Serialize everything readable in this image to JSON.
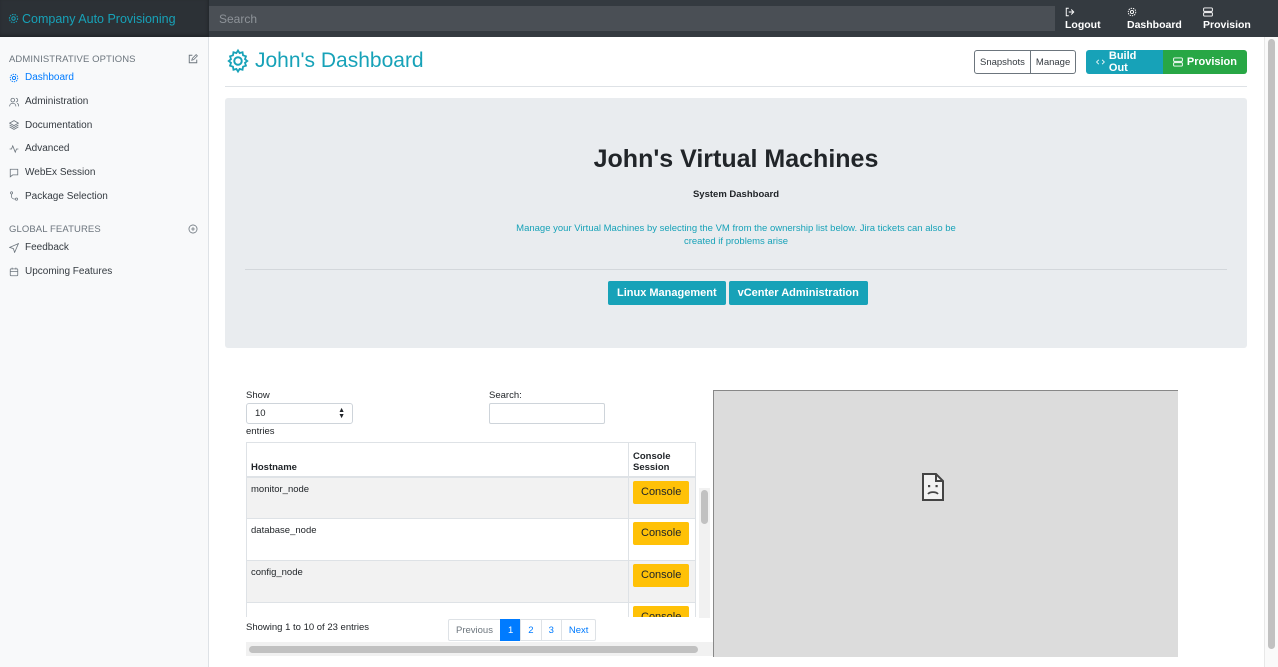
{
  "topbar": {
    "brand": "Company Auto Provisioning",
    "search_placeholder": "Search",
    "nav": {
      "logout": "Logout",
      "dashboard": "Dashboard",
      "provision": "Provision"
    }
  },
  "sidebar": {
    "section1": "ADMINISTRATIVE OPTIONS",
    "items1": [
      "Dashboard",
      "Administration",
      "Documentation",
      "Advanced",
      "WebEx Session",
      "Package Selection"
    ],
    "section2": "GLOBAL FEATURES",
    "items2": [
      "Feedback",
      "Upcoming Features"
    ]
  },
  "header": {
    "title": "John's Dashboard",
    "snapshots": "Snapshots",
    "manage": "Manage",
    "build_out": "Build Out",
    "provision": "Provision"
  },
  "jumbotron": {
    "heading": "John's Virtual Machines",
    "subheading": "System Dashboard",
    "lead": "Manage your Virtual Machines by selecting the VM from the ownership list below. Jira tickets can also be created if problems arise",
    "btn_linux": "Linux Management",
    "btn_vcenter": "vCenter Administration"
  },
  "datatable": {
    "show_label": "Show",
    "length_value": "10",
    "entries_label": "entries",
    "search_label": "Search:",
    "columns": [
      "Hostname",
      "Console Session"
    ],
    "rows": [
      {
        "hostname": "monitor_node",
        "action": "Console"
      },
      {
        "hostname": "database_node",
        "action": "Console"
      },
      {
        "hostname": "config_node",
        "action": "Console"
      },
      {
        "hostname": "",
        "action": "Console"
      }
    ],
    "info": "Showing 1 to 10 of 23 entries",
    "pagination": {
      "previous": "Previous",
      "pages": [
        "1",
        "2",
        "3"
      ],
      "active": "1",
      "next": "Next"
    }
  },
  "colors": {
    "navbar": "#343a40",
    "teal": "#17a2b8",
    "green": "#28a745",
    "warning": "#ffc107",
    "primary": "#007bff"
  }
}
